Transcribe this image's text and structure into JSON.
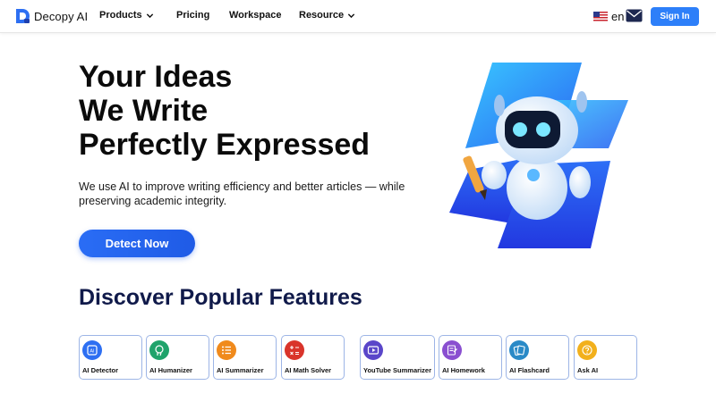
{
  "header": {
    "logo_text": "Decopy AI",
    "nav": [
      {
        "label": "Products",
        "has_dropdown": true
      },
      {
        "label": "Pricing",
        "has_dropdown": false
      },
      {
        "label": "Workspace",
        "has_dropdown": false
      },
      {
        "label": "Resource",
        "has_dropdown": true
      }
    ],
    "language": "en",
    "sign_in_label": "Sign In",
    "icons": {
      "logo": "decopy-logo-icon",
      "flag": "us-flag-icon",
      "mail": "mail-icon",
      "chevron": "chevron-down-icon"
    }
  },
  "hero": {
    "title_lines": [
      "Your Ideas",
      "We Write",
      "Perfectly Expressed"
    ],
    "subtitle": "We use AI to improve writing efficiency and better articles — while preserving academic integrity.",
    "cta_label": "Detect Now"
  },
  "features": {
    "title": "Discover Popular Features",
    "items": [
      {
        "label": "AI Detector",
        "icon": "ai-detector-icon",
        "color": "#2d6ff2"
      },
      {
        "label": "AI Humanizer",
        "icon": "humanizer-icon",
        "color": "#1fa36b"
      },
      {
        "label": "AI Summarizer",
        "icon": "summarizer-icon",
        "color": "#f08a1c"
      },
      {
        "label": "AI Math Solver",
        "icon": "math-solver-icon",
        "color": "#d9342b"
      },
      {
        "label": "YouTube Summarizer",
        "icon": "youtube-summarizer-icon",
        "color": "#5a46c9"
      },
      {
        "label": "AI Homework",
        "icon": "homework-icon",
        "color": "#8a4fd0"
      },
      {
        "label": "AI Flashcard",
        "icon": "flashcard-icon",
        "color": "#2a8ac7"
      },
      {
        "label": "Ask AI",
        "icon": "ask-ai-icon",
        "color": "#f2b01c"
      }
    ]
  },
  "colors": {
    "brand_blue": "#2d7ff9",
    "title_navy": "#101a4a",
    "card_border": "#9db5e6"
  }
}
